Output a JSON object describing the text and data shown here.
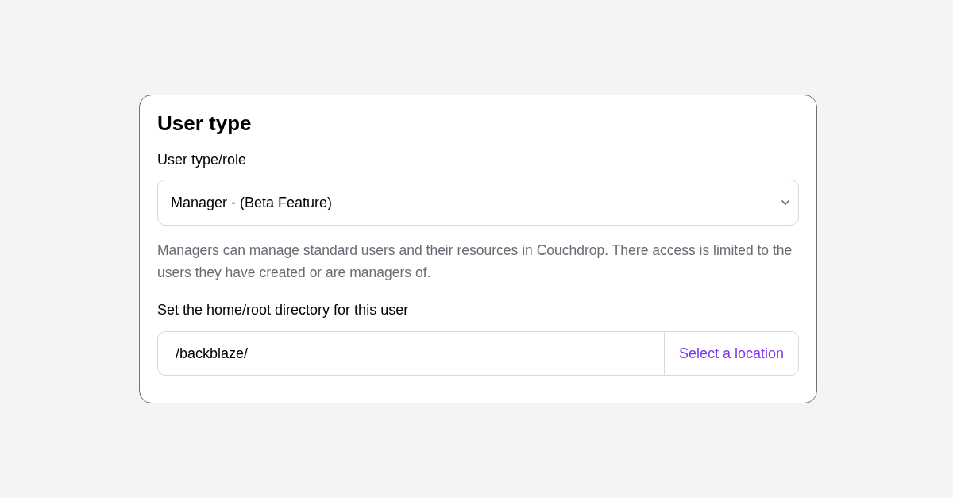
{
  "card": {
    "title": "User type",
    "role_field": {
      "label": "User type/role",
      "value": "Manager - (Beta Feature)"
    },
    "help_text": "Managers can manage standard users and their resources in Couchdrop. There access is limited to the users they have created or are managers of.",
    "directory_field": {
      "label": "Set the home/root directory for this user",
      "value": "/backblaze/",
      "button": "Select a location"
    }
  }
}
